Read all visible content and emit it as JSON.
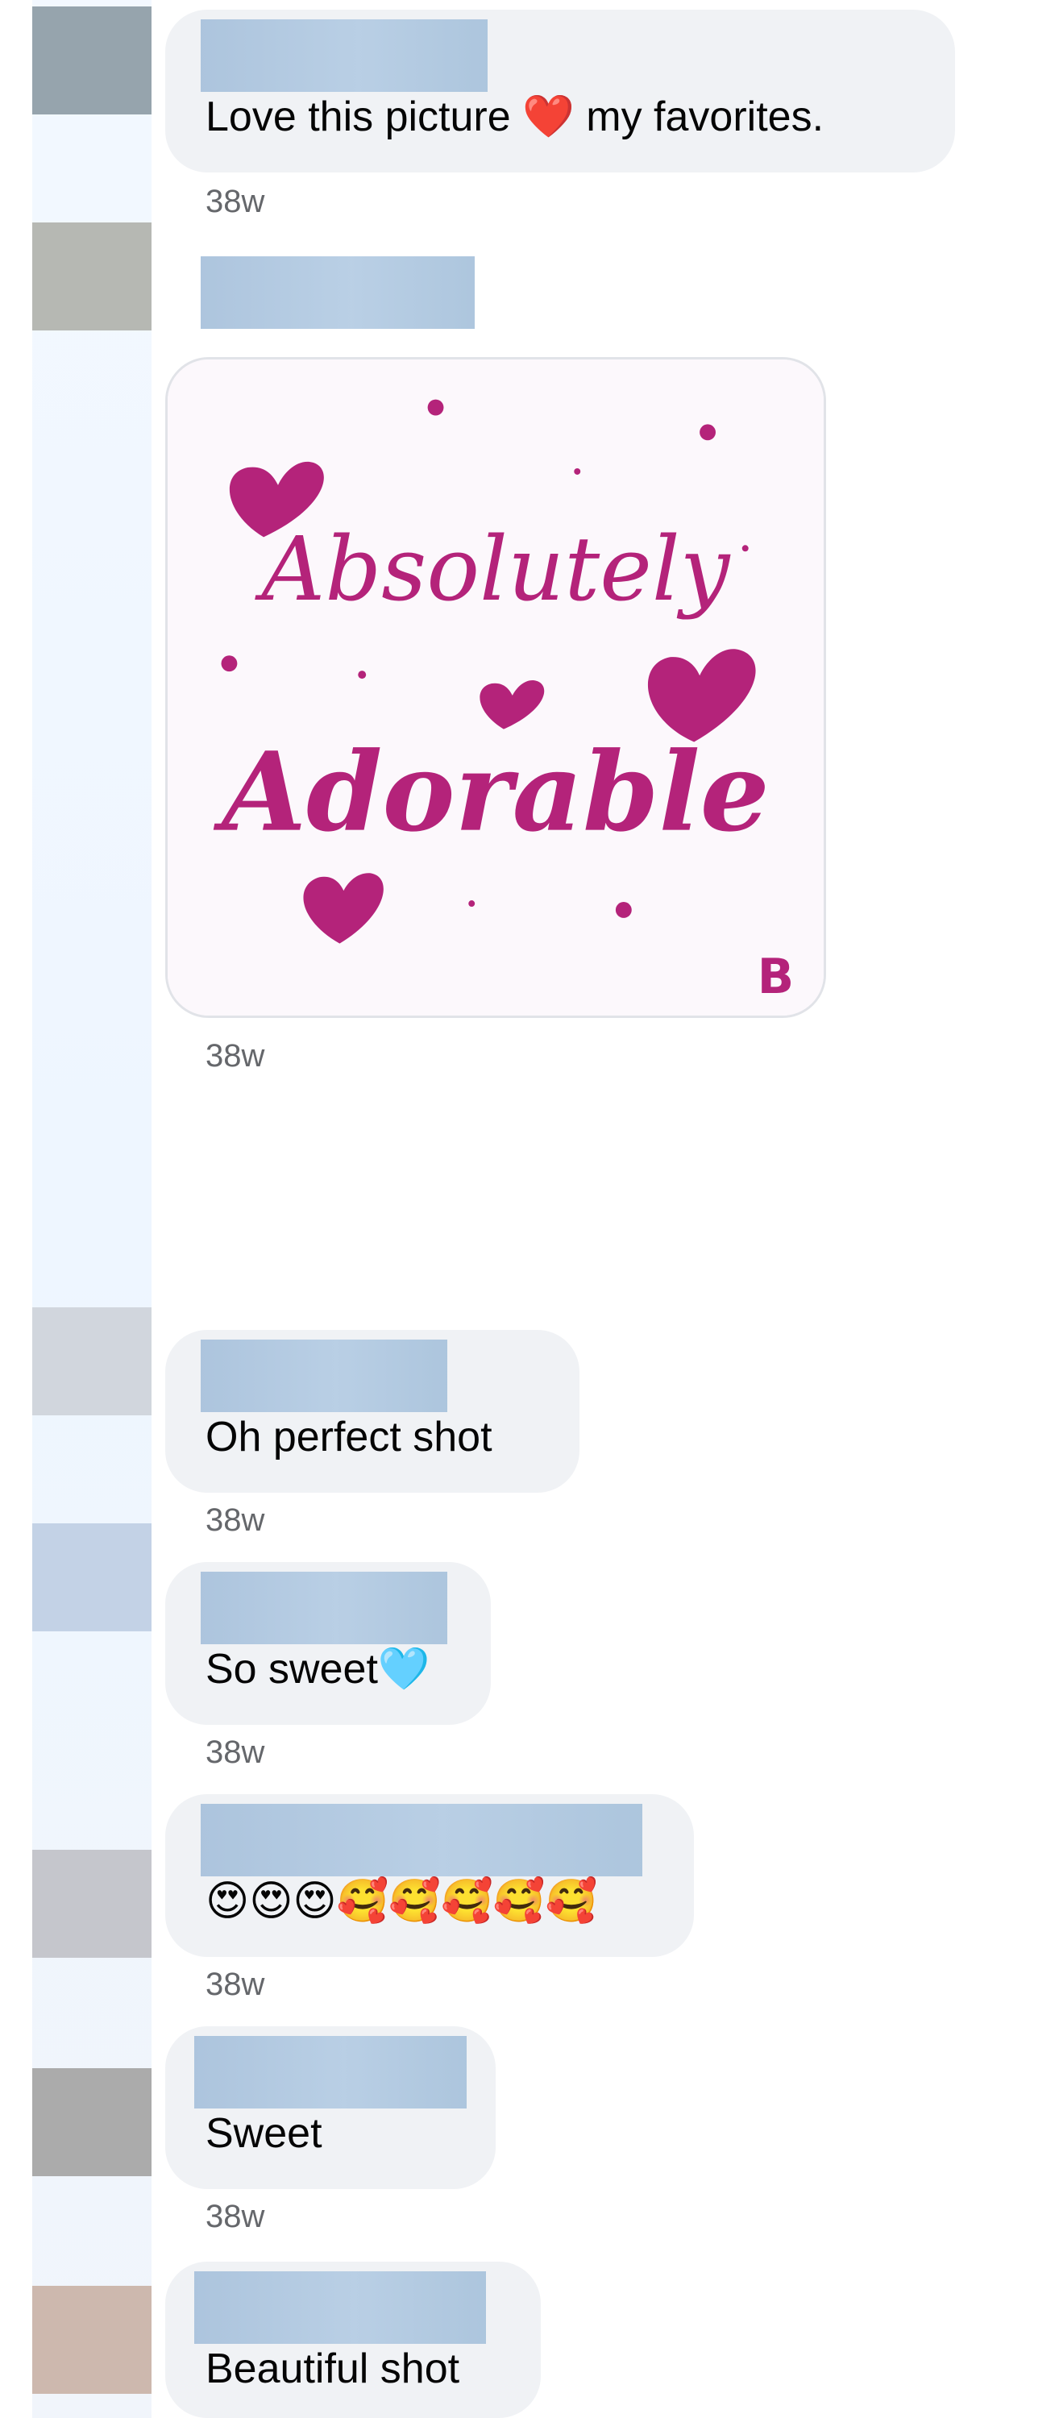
{
  "comments": [
    {
      "text": "Love this picture ❤️ my favorites.",
      "time": "38w",
      "avatar_color": "#96a4ad"
    },
    {
      "image": {
        "line1": "Absolutely",
        "line2": "Adorable",
        "watermark": "B",
        "heart_color": "#b4237a",
        "text_color": "#b4237a"
      },
      "time": "38w",
      "avatar_color": "#b6b8b3"
    },
    {
      "text": "Oh perfect shot",
      "time": "38w",
      "avatar_color": "#d1d6dd"
    },
    {
      "text": "So sweet🩵",
      "time": "38w",
      "avatar_color": "#c3d2e6"
    },
    {
      "text": "😍😍😍🥰🥰🥰🥰🥰",
      "time": "38w",
      "avatar_color": "#c5c6cc"
    },
    {
      "text": "Sweet",
      "time": "38w",
      "avatar_color": "#ababab"
    },
    {
      "text": "Beautiful shot",
      "avatar_color": "#cdb8ae"
    }
  ]
}
